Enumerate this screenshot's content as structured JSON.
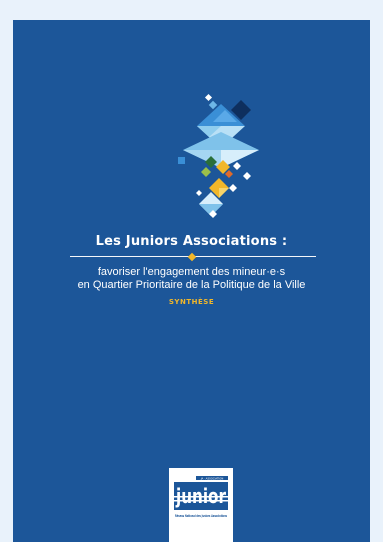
{
  "cover": {
    "title": "Les Juniors Associations :",
    "subtitle_line1": "favoriser l'engagement des mineur·e·s",
    "subtitle_line2": "en Quartier Prioritaire de la Politique de la Ville",
    "label": "SYNTHÈSE"
  },
  "logo": {
    "top_text": "JA · ASSOCIATION",
    "wordmark": "junior",
    "caption": "Réseau National des Juniors Associations"
  },
  "colors": {
    "background": "#1c5699",
    "frame": "#e9f2fb",
    "accent": "#f1b72a",
    "text": "#ffffff"
  }
}
